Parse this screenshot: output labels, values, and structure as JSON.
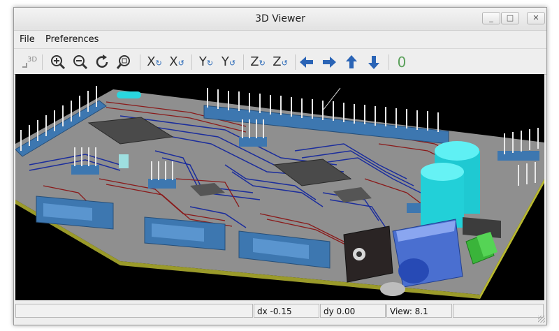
{
  "window": {
    "title": "3D Viewer",
    "controls": {
      "minimize": "_",
      "maximize": "□",
      "close": "✕"
    }
  },
  "menubar": {
    "items": [
      {
        "label": "File"
      },
      {
        "label": "Preferences"
      }
    ]
  },
  "toolbar": {
    "reload_label": "3D",
    "x_label": "X",
    "y_label": "Y",
    "z_label": "Z",
    "ortho_label": "0",
    "icons": [
      "reload-3d-icon",
      "zoom-in-icon",
      "zoom-out-icon",
      "redraw-icon",
      "zoom-fit-icon",
      "rotate-x-cw-icon",
      "rotate-x-ccw-icon",
      "rotate-y-cw-icon",
      "rotate-y-ccw-icon",
      "rotate-z-cw-icon",
      "rotate-z-ccw-icon",
      "move-left-icon",
      "move-right-icon",
      "move-up-icon",
      "move-down-icon",
      "ortho-toggle-icon"
    ]
  },
  "viewport": {
    "board_color": "#8f8f8f",
    "trace_blue": "#1b2d9c",
    "trace_red": "#8a1a1a",
    "connector_blue": "#3d77b0",
    "capacitor_cyan": "#2ad6de",
    "pin_color": "#e8e8e8"
  },
  "statusbar": {
    "dx": "dx -0.15",
    "dy": "dy 0.00",
    "view": "View: 8.1"
  }
}
